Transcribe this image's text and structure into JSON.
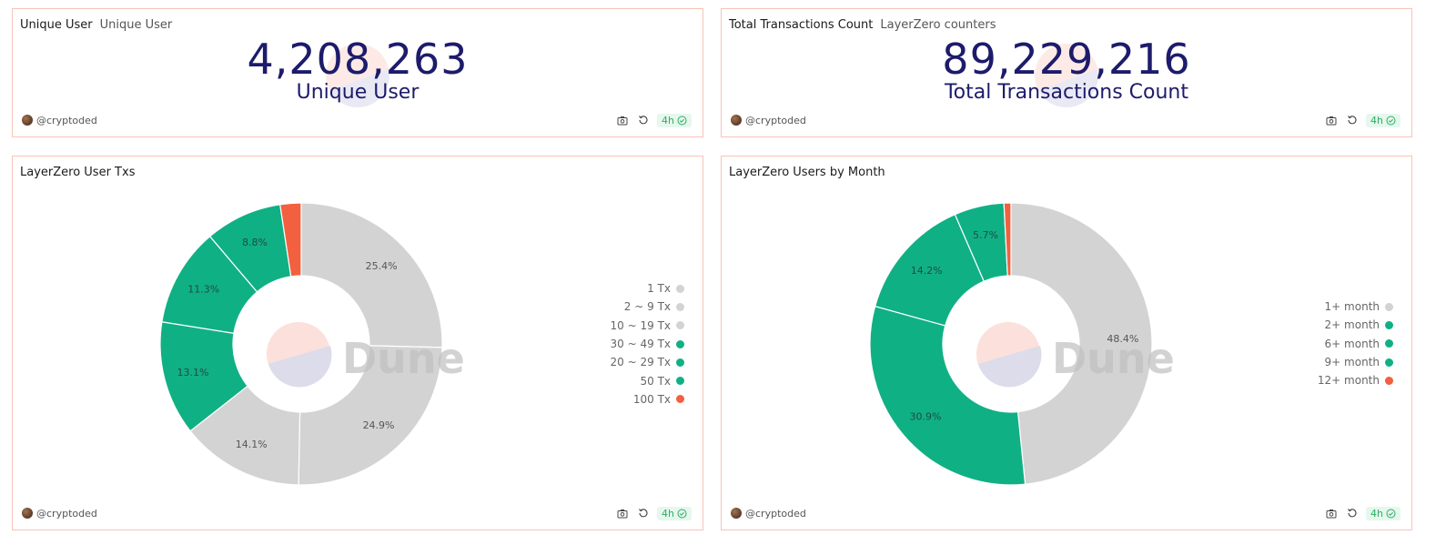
{
  "colors": {
    "gray": "#d3d3d3",
    "green": "#10b085",
    "red": "#f2603f",
    "navy": "#1d1b6b",
    "border": "#f8c3b6"
  },
  "cards": {
    "unique_user": {
      "title": "Unique User",
      "subtitle": "Unique User",
      "value": "4,208,263",
      "label": "Unique User",
      "author": "@cryptoded",
      "refresh": "4h"
    },
    "total_tx": {
      "title": "Total Transactions Count",
      "subtitle": "LayerZero counters",
      "value": "89,229,216",
      "label": "Total Transactions Count",
      "author": "@cryptoded",
      "refresh": "4h"
    },
    "user_txs": {
      "title": "LayerZero User Txs",
      "author": "@cryptoded",
      "refresh": "4h"
    },
    "users_month": {
      "title": "LayerZero Users by Month",
      "author": "@cryptoded",
      "refresh": "4h"
    }
  },
  "watermark": "Dune",
  "chart_data": [
    {
      "type": "pie",
      "title": "LayerZero User Txs",
      "legend_position": "right",
      "categories": [
        "1 Tx",
        "2 ~ 9 Tx",
        "10 ~ 19 Tx",
        "30 ~ 49 Tx",
        "20 ~ 29 Tx",
        "50 Tx",
        "100 Tx"
      ],
      "values": [
        25.4,
        24.9,
        14.1,
        13.1,
        11.3,
        8.8,
        2.4
      ],
      "labels": [
        "25.4%",
        "24.9%",
        "14.1%",
        "13.1%",
        "11.3%",
        "8.8%",
        ""
      ],
      "colors": [
        "#d3d3d3",
        "#d3d3d3",
        "#d3d3d3",
        "#10b085",
        "#10b085",
        "#10b085",
        "#f2603f"
      ],
      "donut": true
    },
    {
      "type": "pie",
      "title": "LayerZero Users by Month",
      "legend_position": "right",
      "categories": [
        "1+ month",
        "2+ month",
        "6+ month",
        "9+ month",
        "12+ month"
      ],
      "values": [
        48.4,
        30.9,
        14.2,
        5.7,
        0.8
      ],
      "labels": [
        "48.4%",
        "30.9%",
        "14.2%",
        "5.7%",
        ""
      ],
      "colors": [
        "#d3d3d3",
        "#10b085",
        "#10b085",
        "#10b085",
        "#f2603f"
      ],
      "donut": true
    }
  ]
}
